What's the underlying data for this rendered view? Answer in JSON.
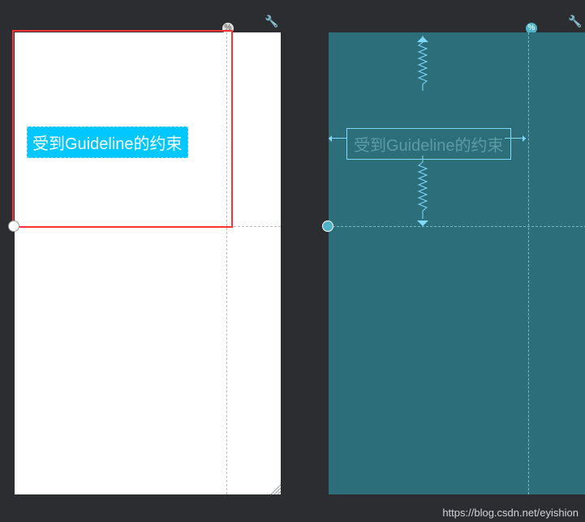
{
  "left": {
    "text": "受到Guideline的约束",
    "pctSymbol": "%",
    "vGuidelinePercent": 0.8,
    "hGuidelinePercent": 0.42
  },
  "right": {
    "text": "受到Guideline的约束",
    "pctSymbol": "%",
    "vGuidelinePercent": 0.75,
    "hGuidelinePercent": 0.42
  },
  "icons": {
    "wrench": "🔧"
  },
  "watermark": "https://blog.csdn.net/eyishion"
}
